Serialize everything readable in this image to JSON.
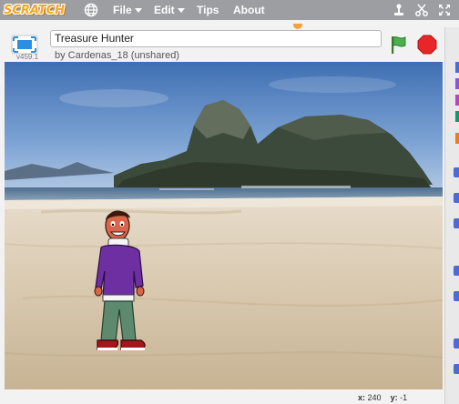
{
  "menubar": {
    "logo": "SCRATCH",
    "items": [
      {
        "label": "File",
        "has_caret": true
      },
      {
        "label": "Edit",
        "has_caret": true
      },
      {
        "label": "Tips",
        "has_caret": false
      },
      {
        "label": "About",
        "has_caret": false
      }
    ],
    "icons": [
      "globe-icon",
      "duplicate-icon",
      "cut-icon",
      "grow-icon",
      "shrink-icon"
    ]
  },
  "project": {
    "title": "Treasure Hunter",
    "byline": "by Cardenas_18 (unshared)",
    "version": "v459.1"
  },
  "controls": {
    "green_flag": "green-flag-icon",
    "stop": "stop-icon"
  },
  "stage": {
    "backdrop": "Rio beach with Sugarloaf mountain",
    "sprite": "boy in purple sweater"
  },
  "status": {
    "x_label": "x:",
    "x_value": "240",
    "y_label": "y:",
    "y_value": "-1"
  },
  "colors": {
    "menubar": "#9c9ea2",
    "accent": "#f5a623",
    "flag": "#4caf50",
    "stop": "#e8262a"
  }
}
